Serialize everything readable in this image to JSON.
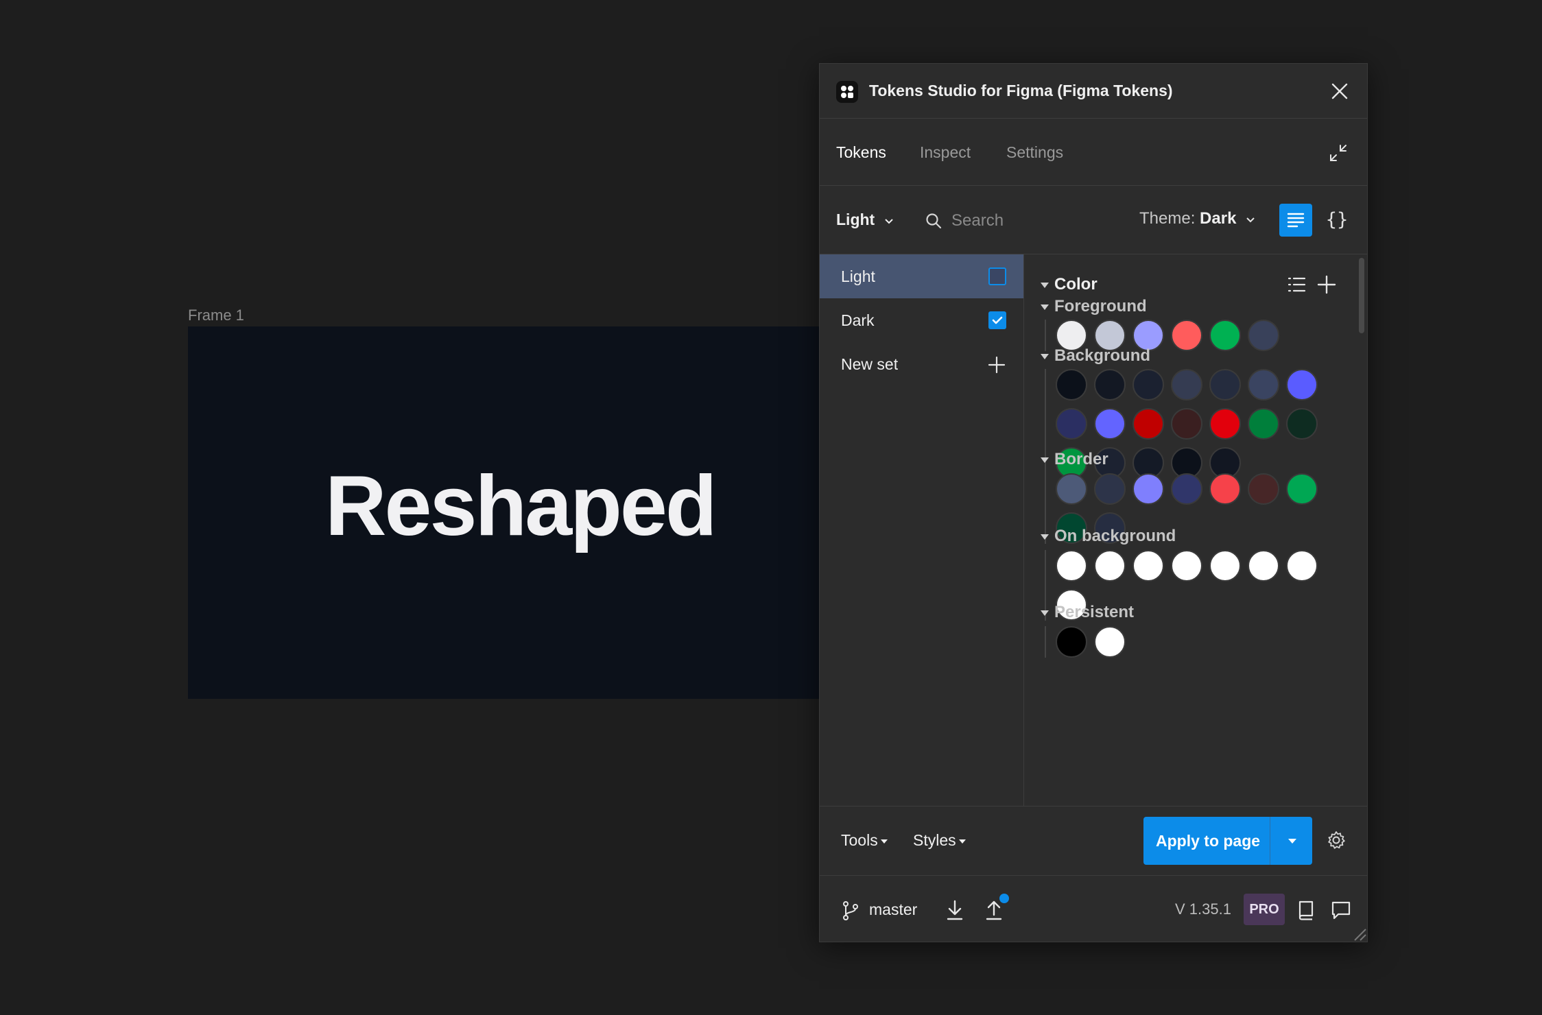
{
  "canvas": {
    "frame_label": "Frame 1",
    "frame_text": "Reshaped"
  },
  "plugin": {
    "title": "Tokens Studio for Figma (Figma Tokens)",
    "tabs": [
      "Tokens",
      "Inspect",
      "Settings"
    ],
    "active_tab": "Tokens",
    "toolbar": {
      "set_selector": "Light",
      "search_placeholder": "Search",
      "theme_label": "Theme:",
      "theme_value": "Dark"
    },
    "sets": [
      {
        "label": "Light",
        "checked": false,
        "active": true
      },
      {
        "label": "Dark",
        "checked": true,
        "active": false
      }
    ],
    "new_set_label": "New set",
    "token_section": "Color",
    "groups": [
      {
        "name": "Foreground",
        "colors": [
          "#eeeef0",
          "#c3c8d7",
          "#9a9cff",
          "#ff5c5c",
          "#00b152",
          "#39415a"
        ]
      },
      {
        "name": "Background",
        "colors": [
          "#0c111a",
          "#131823",
          "#1b2130",
          "#353c52",
          "#252c3e",
          "#3a4461",
          "#5a5cff",
          "#2b2f62",
          "#6364ff",
          "#c00000",
          "#3a1f20",
          "#e2000c",
          "#007f3b",
          "#0e2c21",
          "#00953f",
          "#1c2231",
          "#141a26",
          "#0c111a",
          "#121722"
        ]
      },
      {
        "name": "Border",
        "colors": [
          "#4d5a78",
          "#2d3449",
          "#7f7ffd",
          "#30366a",
          "#f6424a",
          "#472627",
          "#00a753",
          "#014730",
          "#262d41"
        ]
      },
      {
        "name": "On background",
        "colors": [
          "#ffffff",
          "#ffffff",
          "#ffffff",
          "#ffffff",
          "#ffffff",
          "#ffffff",
          "#ffffff",
          "#ffffff"
        ]
      },
      {
        "name": "Persistent",
        "colors": [
          "#000000",
          "#ffffff"
        ]
      }
    ],
    "footer": {
      "tools": "Tools",
      "styles": "Styles",
      "apply_button": "Apply to page",
      "branch": "master",
      "version": "V 1.35.1",
      "badge": "PRO"
    },
    "accent_color": "#0c8ce9"
  }
}
